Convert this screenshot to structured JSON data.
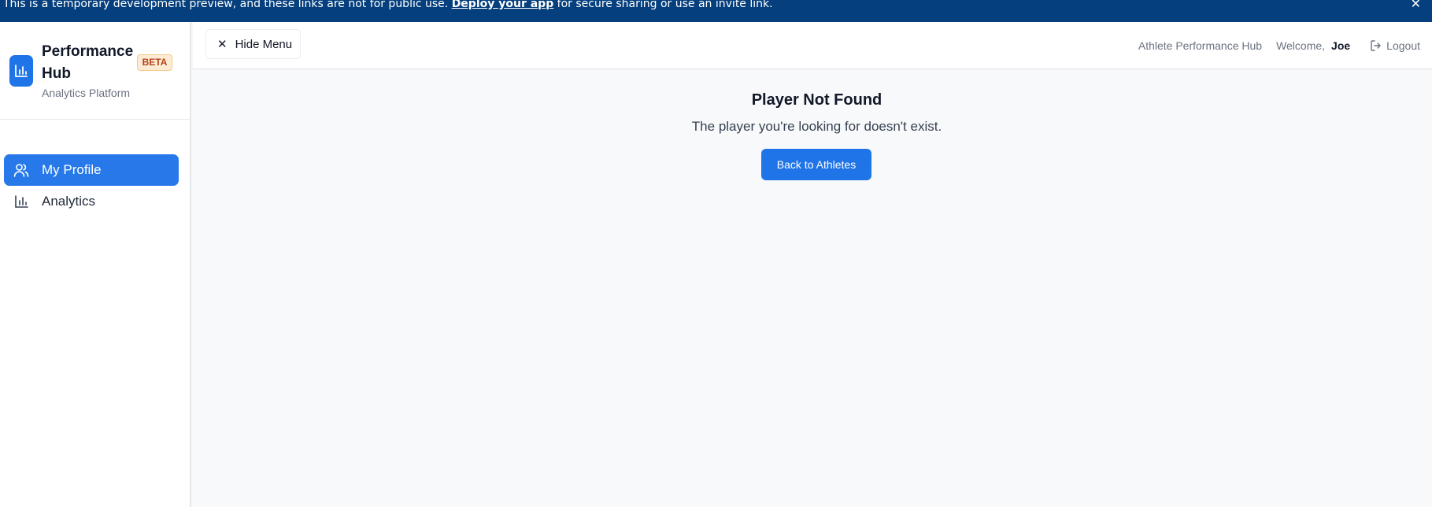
{
  "banner": {
    "text_before": "This is a temporary development preview, and these links are not for public use. ",
    "link_text": "Deploy your app",
    "text_after": " for secure sharing or use an invite link.",
    "close_icon": "close-icon",
    "background": "#053f7d"
  },
  "sidebar": {
    "brand": {
      "title": "Performance Hub",
      "badge": "BETA",
      "subtitle": "Analytics Platform",
      "icon": "bar-chart-icon"
    },
    "items": [
      {
        "label": "My Profile",
        "icon": "users-icon",
        "active": true
      },
      {
        "label": "Analytics",
        "icon": "bar-chart-icon",
        "active": false
      }
    ]
  },
  "header": {
    "hide_menu_label": "Hide Menu",
    "hide_menu_icon": "close-icon",
    "app_name": "Athlete Performance Hub",
    "welcome_label": "Welcome,",
    "user_name": "Joe",
    "logout_label": "Logout",
    "logout_icon": "logout-icon"
  },
  "main": {
    "title": "Player Not Found",
    "message": "The player you're looking for doesn't exist.",
    "back_button_label": "Back to Athletes"
  },
  "colors": {
    "accent": "#1f74e8",
    "banner": "#053f7d",
    "badge_bg": "#fdecd3",
    "badge_text": "#b4421b"
  }
}
